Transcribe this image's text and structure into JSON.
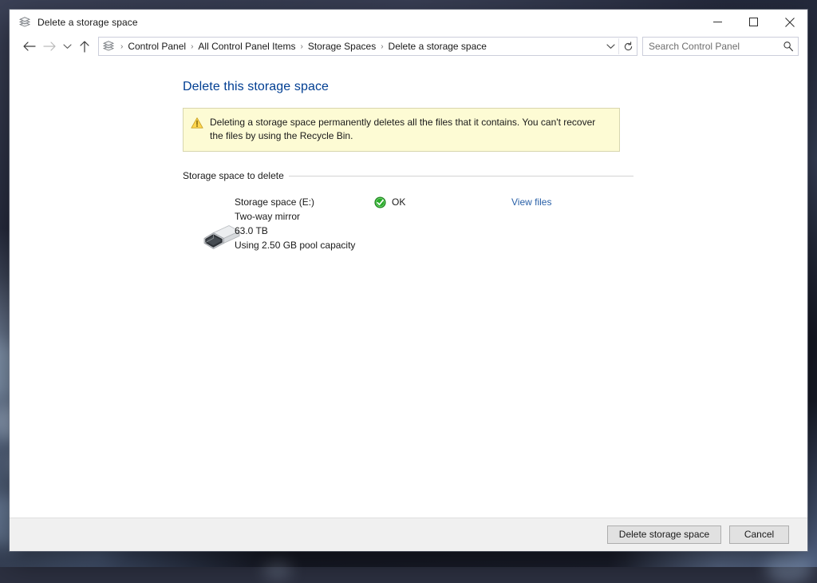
{
  "window": {
    "title": "Delete a storage space",
    "title_icon": "storage-spaces-icon",
    "controls": {
      "minimize": "Minimize",
      "maximize": "Maximize",
      "close": "Close"
    }
  },
  "navbar": {
    "back": "Back",
    "forward": "Forward",
    "recent_locations": "Recent locations",
    "up": "Up one level",
    "crumb_icon": "storage-spaces-icon",
    "breadcrumbs": [
      "Control Panel",
      "All Control Panel Items",
      "Storage Spaces",
      "Delete a storage space"
    ],
    "separator": "›",
    "dropdown": "Previous locations",
    "refresh": "Refresh",
    "search": {
      "placeholder": "Search Control Panel",
      "value": "",
      "icon": "search-icon"
    }
  },
  "main": {
    "page_title": "Delete this storage space",
    "warning": {
      "icon": "warning-triangle-icon",
      "text": "Deleting a storage space permanently deletes all the files that it contains. You can't recover the files by using the Recycle Bin.",
      "background": "#fdfbd4",
      "border": "#d8d6ae"
    },
    "group_label": "Storage space to delete",
    "space": {
      "icon": "external-drive-icon",
      "name": "Storage space (E:)",
      "resiliency": "Two-way mirror",
      "size": "63.0 TB",
      "pool_usage": "Using 2.50 GB pool capacity",
      "status_icon": "status-ok-icon",
      "status": "OK",
      "status_color": "#21a121",
      "view_files_link": "View files",
      "link_color": "#2a61a8"
    }
  },
  "footer": {
    "delete_button": "Delete storage space",
    "cancel_button": "Cancel"
  },
  "theme": {
    "accent_heading": "#003e92",
    "window_bg": "#ffffff",
    "footer_bg": "#f0f0f0"
  }
}
